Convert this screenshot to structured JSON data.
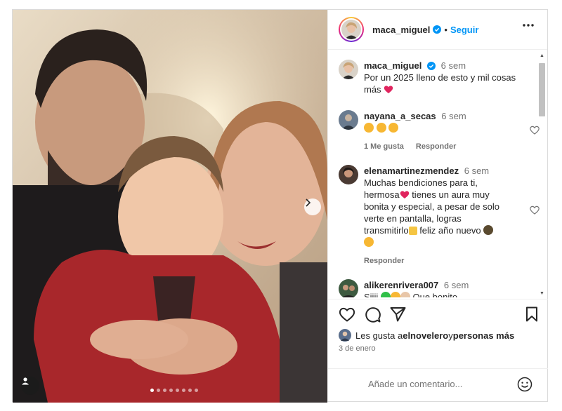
{
  "post": {
    "username": "maca_miguel",
    "follow_label": "Seguir",
    "header_separator": "•",
    "caption": {
      "username": "maca_miguel",
      "time": "6 sem",
      "text": "Por un 2025 lleno de esto y mil cosas más"
    },
    "carousel": {
      "total_slides": 8,
      "active_slide": 1
    }
  },
  "comments": [
    {
      "username": "nayana_a_secas",
      "time": "6 sem",
      "likes_label": "1 Me gusta",
      "reply_label": "Responder"
    },
    {
      "username": "elenamartinezmendez",
      "time": "6 sem",
      "line1": "Muchas bendiciones para ti,",
      "line2a": "hermosa",
      "line2b": " tienes un aura muy",
      "line3": "bonita y especial, a pesar de solo",
      "line4": "verte en pantalla, logras",
      "line5a": "transmitirlo",
      "line5b": " feliz año nuevo",
      "reply_label": "Responder"
    },
    {
      "username": "alikerenrivera007",
      "time": "6 sem",
      "text_tail": "Que bonito",
      "text_head": "Siiii"
    }
  ],
  "likes": {
    "prefix": "Les gusta a ",
    "user": "elnovelero",
    "middle": " y ",
    "suffix": "personas más"
  },
  "date": "3 de enero",
  "add_comment": {
    "placeholder": "Añade un comentario..."
  },
  "icons": {
    "like": "heart-icon",
    "comment": "comment-icon",
    "share": "send-icon",
    "save": "bookmark-icon",
    "more": "more-horizontal-icon",
    "next": "chevron-right-icon",
    "tag": "user-tag-icon",
    "emoji": "smiley-icon"
  },
  "colors": {
    "accent": "#0095f6",
    "heart_red": "#ed4956",
    "text": "#262626",
    "muted": "#737373"
  }
}
